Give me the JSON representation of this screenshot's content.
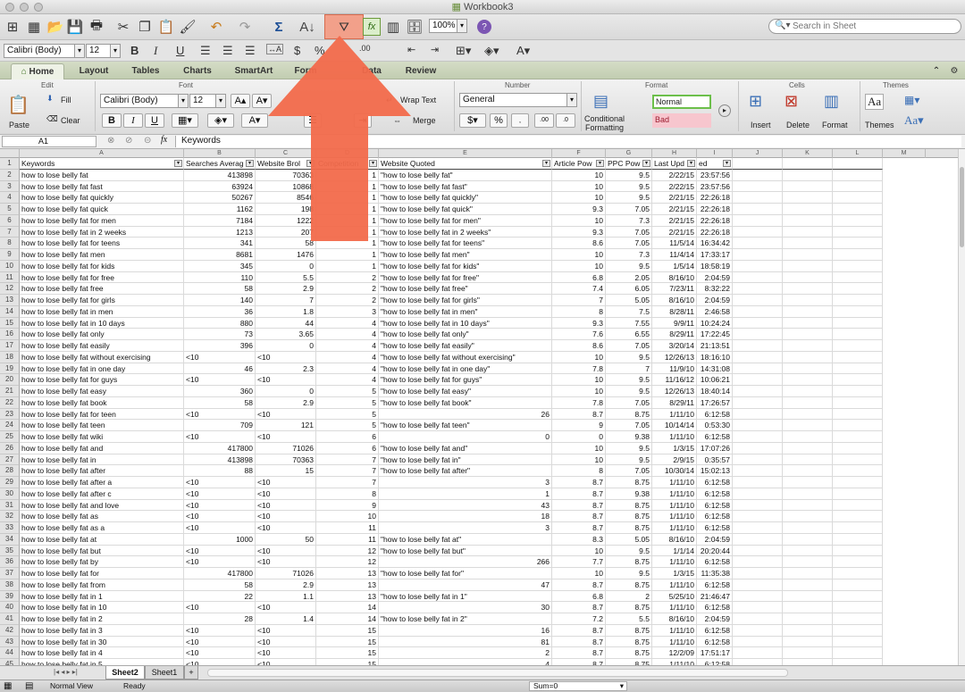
{
  "window": {
    "title": "Workbook3"
  },
  "toolbar": {
    "search_placeholder": "Search in Sheet",
    "zoom": "100%"
  },
  "format_bar": {
    "font": "Calibri (Body)",
    "size": "12",
    "bold": "B",
    "italic": "I",
    "underline": "U"
  },
  "tabs": [
    "Home",
    "Layout",
    "Tables",
    "Charts",
    "SmartArt",
    "Form",
    "Data",
    "Review"
  ],
  "ribbon": {
    "groups": {
      "edit": "Edit",
      "font": "Font",
      "number": "Number",
      "format": "Format",
      "cells": "Cells",
      "themes": "Themes"
    },
    "fill": "Fill",
    "clear": "Clear",
    "paste": "Paste",
    "font_name": "Calibri (Body)",
    "font_size": "12",
    "wrap": "Wrap Text",
    "merge": "Merge",
    "number_format": "General",
    "cond_format_1": "Conditional",
    "cond_format_2": "Formatting",
    "style_normal": "Normal",
    "style_bad": "Bad",
    "insert": "Insert",
    "delete": "Delete",
    "format_btn": "Format",
    "themes_btn": "Themes",
    "aa": "Aa"
  },
  "formula_bar": {
    "cell_ref": "A1",
    "fx": "fx",
    "content": "Keywords"
  },
  "columns": [
    "A",
    "B",
    "C",
    "D",
    "E",
    "F",
    "G",
    "H",
    "I",
    "J",
    "K",
    "L",
    "M"
  ],
  "headers": [
    "Keywords",
    "Searches Averag",
    "Website Brol",
    "Competition",
    "Website Quoted",
    "Article Pow",
    "PPC Pow",
    "Last Upd",
    "ed"
  ],
  "rows": [
    [
      "how to lose belly fat",
      "413898",
      "70363",
      "1",
      "\"how to lose belly fat\"",
      "10",
      "9.5",
      "2/22/15",
      "23:57:56"
    ],
    [
      "how to lose belly fat fast",
      "63924",
      "10868",
      "1",
      "\"how to lose belly fat fast\"",
      "10",
      "9.5",
      "2/22/15",
      "23:57:56"
    ],
    [
      "how to lose belly fat quickly",
      "50267",
      "8546",
      "1",
      "\"how to lose belly fat quickly\"",
      "10",
      "9.5",
      "2/21/15",
      "22:26:18"
    ],
    [
      "how to lose belly fat quick",
      "1162",
      "198",
      "1",
      "\"how to lose belly fat quick\"",
      "9.3",
      "7.05",
      "2/21/15",
      "22:26:18"
    ],
    [
      "how to lose belly fat for men",
      "7184",
      "1222",
      "1",
      "\"how to lose belly fat for men\"",
      "10",
      "7.3",
      "2/21/15",
      "22:26:18"
    ],
    [
      "how to lose belly fat in 2 weeks",
      "1213",
      "207",
      "1",
      "\"how to lose belly fat in 2 weeks\"",
      "9.3",
      "7.05",
      "2/21/15",
      "22:26:18"
    ],
    [
      "how to lose belly fat for teens",
      "341",
      "58",
      "1",
      "\"how to lose belly fat for teens\"",
      "8.6",
      "7.05",
      "11/5/14",
      "16:34:42"
    ],
    [
      "how to lose belly fat men",
      "8681",
      "1476",
      "1",
      "\"how to lose belly fat men\"",
      "10",
      "7.3",
      "11/4/14",
      "17:33:17"
    ],
    [
      "how to lose belly fat for kids",
      "345",
      "0",
      "1",
      "\"how to lose belly fat for kids\"",
      "10",
      "9.5",
      "1/5/14",
      "18:58:19"
    ],
    [
      "how to lose belly fat for free",
      "110",
      "5.5",
      "2",
      "\"how to lose belly fat for free\"",
      "6.8",
      "2.05",
      "8/16/10",
      "2:04:59"
    ],
    [
      "how to lose belly fat free",
      "58",
      "2.9",
      "2",
      "\"how to lose belly fat free\"",
      "7.4",
      "6.05",
      "7/23/11",
      "8:32:22"
    ],
    [
      "how to lose belly fat for girls",
      "140",
      "7",
      "2",
      "\"how to lose belly fat for girls\"",
      "7",
      "5.05",
      "8/16/10",
      "2:04:59"
    ],
    [
      "how to lose belly fat in men",
      "36",
      "1.8",
      "3",
      "\"how to lose belly fat in men\"",
      "8",
      "7.5",
      "8/28/11",
      "2:46:58"
    ],
    [
      "how to lose belly fat in 10 days",
      "880",
      "44",
      "4",
      "\"how to lose belly fat in 10 days\"",
      "9.3",
      "7.55",
      "9/9/11",
      "10:24:24"
    ],
    [
      "how to lose belly fat only",
      "73",
      "3.65",
      "4",
      "\"how to lose belly fat only\"",
      "7.6",
      "6.55",
      "8/29/11",
      "17:22:45"
    ],
    [
      "how to lose belly fat easily",
      "396",
      "0",
      "4",
      "\"how to lose belly fat easily\"",
      "8.6",
      "7.05",
      "3/20/14",
      "21:13:51"
    ],
    [
      "how to lose belly fat without exercising",
      "<10",
      "<10",
      "4",
      "\"how to lose belly fat without exercising\"",
      "10",
      "9.5",
      "12/26/13",
      "18:16:10"
    ],
    [
      "how to lose belly fat in one day",
      "46",
      "2.3",
      "4",
      "\"how to lose belly fat in one day\"",
      "7.8",
      "7",
      "11/9/10",
      "14:31:08"
    ],
    [
      "how to lose belly fat for guys",
      "<10",
      "<10",
      "4",
      "\"how to lose belly fat for guys\"",
      "10",
      "9.5",
      "11/16/12",
      "10:06:21"
    ],
    [
      "how to lose belly fat easy",
      "360",
      "0",
      "5",
      "\"how to lose belly fat easy\"",
      "10",
      "9.5",
      "12/26/13",
      "18:40:14"
    ],
    [
      "how to lose belly fat book",
      "58",
      "2.9",
      "5",
      "\"how to lose belly fat book\"",
      "7.8",
      "7.05",
      "8/29/11",
      "17:26:57"
    ],
    [
      "how to lose belly fat for teen",
      "<10",
      "<10",
      "5",
      "26",
      "8.7",
      "8.75",
      "1/11/10",
      "6:12:58"
    ],
    [
      "how to lose belly fat teen",
      "709",
      "121",
      "5",
      "\"how to lose belly fat teen\"",
      "9",
      "7.05",
      "10/14/14",
      "0:53:30"
    ],
    [
      "how to lose belly fat wiki",
      "<10",
      "<10",
      "6",
      "0",
      "0",
      "9.38",
      "1/11/10",
      "6:12:58"
    ],
    [
      "how to lose belly fat and",
      "417800",
      "71026",
      "6",
      "\"how to lose belly fat and\"",
      "10",
      "9.5",
      "1/3/15",
      "17:07:26"
    ],
    [
      "how to lose belly fat in",
      "413898",
      "70363",
      "7",
      "\"how to lose belly fat in\"",
      "10",
      "9.5",
      "2/9/15",
      "0:35:57"
    ],
    [
      "how to lose belly fat after",
      "88",
      "15",
      "7",
      "\"how to lose belly fat after\"",
      "8",
      "7.05",
      "10/30/14",
      "15:02:13"
    ],
    [
      "how to lose belly fat after a",
      "<10",
      "<10",
      "7",
      "3",
      "8.7",
      "8.75",
      "1/11/10",
      "6:12:58"
    ],
    [
      "how to lose belly fat after c",
      "<10",
      "<10",
      "8",
      "1",
      "8.7",
      "9.38",
      "1/11/10",
      "6:12:58"
    ],
    [
      "how to lose belly fat and love",
      "<10",
      "<10",
      "9",
      "43",
      "8.7",
      "8.75",
      "1/11/10",
      "6:12:58"
    ],
    [
      "how to lose belly fat as",
      "<10",
      "<10",
      "10",
      "18",
      "8.7",
      "8.75",
      "1/11/10",
      "6:12:58"
    ],
    [
      "how to lose belly fat as a",
      "<10",
      "<10",
      "11",
      "3",
      "8.7",
      "8.75",
      "1/11/10",
      "6:12:58"
    ],
    [
      "how to lose belly fat at",
      "1000",
      "50",
      "11",
      "\"how to lose belly fat at\"",
      "8.3",
      "5.05",
      "8/16/10",
      "2:04:59"
    ],
    [
      "how to lose belly fat but",
      "<10",
      "<10",
      "12",
      "\"how to lose belly fat but\"",
      "10",
      "9.5",
      "1/1/14",
      "20:20:44"
    ],
    [
      "how to lose belly fat by",
      "<10",
      "<10",
      "12",
      "266",
      "7.7",
      "8.75",
      "1/11/10",
      "6:12:58"
    ],
    [
      "how to lose belly fat for",
      "417800",
      "71026",
      "13",
      "\"how to lose belly fat for\"",
      "10",
      "9.5",
      "1/3/15",
      "11:35:38"
    ],
    [
      "how to lose belly fat from",
      "58",
      "2.9",
      "13",
      "47",
      "8.7",
      "8.75",
      "1/11/10",
      "6:12:58"
    ],
    [
      "how to lose belly fat in 1",
      "22",
      "1.1",
      "13",
      "\"how to lose belly fat in 1\"",
      "6.8",
      "2",
      "5/25/10",
      "21:46:47"
    ],
    [
      "how to lose belly fat in 10",
      "<10",
      "<10",
      "14",
      "30",
      "8.7",
      "8.75",
      "1/11/10",
      "6:12:58"
    ],
    [
      "how to lose belly fat in 2",
      "28",
      "1.4",
      "14",
      "\"how to lose belly fat in 2\"",
      "7.2",
      "5.5",
      "8/16/10",
      "2:04:59"
    ],
    [
      "how to lose belly fat in 3",
      "<10",
      "<10",
      "15",
      "16",
      "8.7",
      "8.75",
      "1/11/10",
      "6:12:58"
    ],
    [
      "how to lose belly fat in 30",
      "<10",
      "<10",
      "15",
      "81",
      "8.7",
      "8.75",
      "1/11/10",
      "6:12:58"
    ],
    [
      "how to lose belly fat in 4",
      "<10",
      "<10",
      "15",
      "2",
      "8.7",
      "8.75",
      "12/2/09",
      "17:51:17"
    ],
    [
      "how to lose belly fat in 5",
      "<10",
      "<10",
      "15",
      "4",
      "8.7",
      "8.75",
      "1/11/10",
      "6:12:58"
    ]
  ],
  "sheet_tabs": [
    "Sheet2",
    "Sheet1"
  ],
  "status": {
    "view": "Normal View",
    "state": "Ready",
    "sum": "Sum=0"
  }
}
